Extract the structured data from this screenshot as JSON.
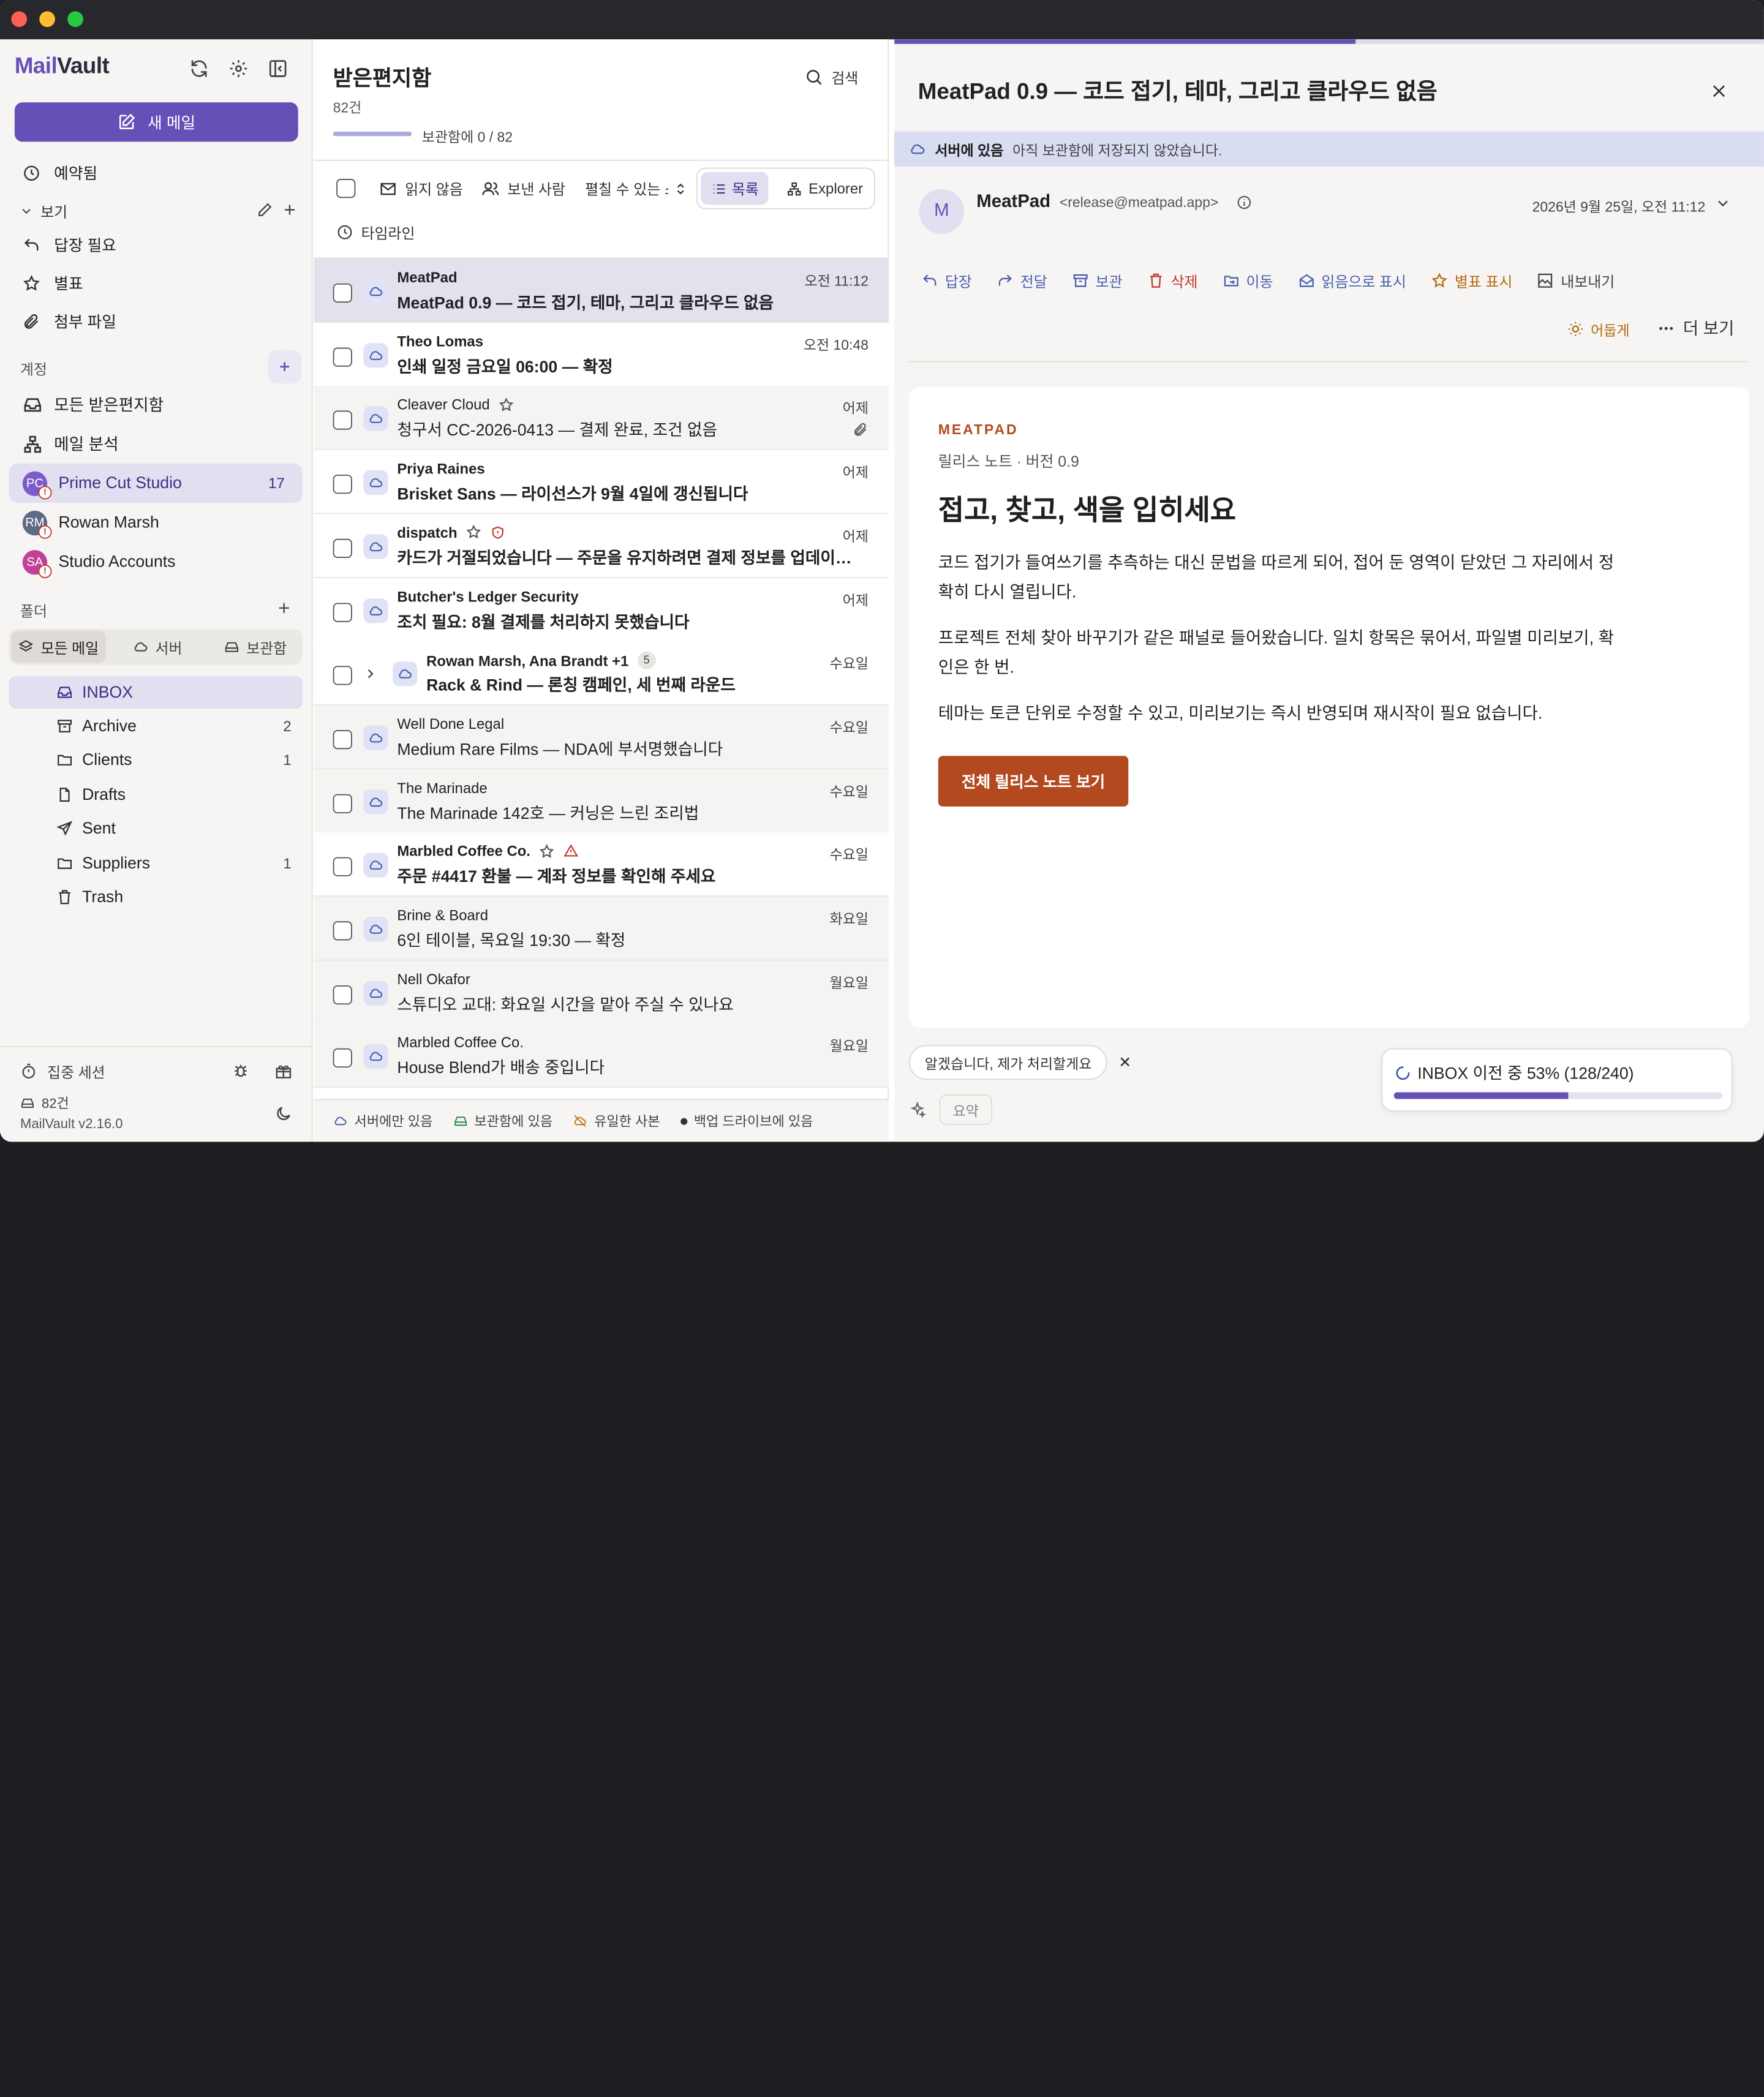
{
  "app": {
    "name_part1": "Mail",
    "name_part2": "Vault"
  },
  "colors": {
    "accent": "#6650b8",
    "danger": "#c0392b",
    "orange": "#b34a1f",
    "link": "#4a5fb0"
  },
  "sidebar": {
    "compose_label": "새 메일",
    "scheduled": "예약됨",
    "views_label": "보기",
    "views": [
      "답장 필요",
      "별표",
      "첨부 파일"
    ],
    "accounts_label": "계정",
    "all_inboxes": "모든 받은편지함",
    "mail_analysis": "메일 분석",
    "accounts": [
      {
        "name": "Prime Cut Studio",
        "initials": "PC",
        "count": "17",
        "color": "#7b5cc9"
      },
      {
        "name": "Rowan Marsh",
        "initials": "RM",
        "count": "",
        "color": "#5d6b87"
      },
      {
        "name": "Studio Accounts",
        "initials": "SA",
        "count": "",
        "color": "#c2409a"
      }
    ],
    "folders_label": "폴더",
    "folder_tabs": [
      "모든 메일",
      "서버",
      "보관함"
    ],
    "folders": [
      {
        "name": "INBOX",
        "count": ""
      },
      {
        "name": "Archive",
        "count": "2"
      },
      {
        "name": "Clients",
        "count": "1"
      },
      {
        "name": "Drafts",
        "count": ""
      },
      {
        "name": "Sent",
        "count": ""
      },
      {
        "name": "Suppliers",
        "count": "1"
      },
      {
        "name": "Trash",
        "count": ""
      }
    ],
    "focus_session": "집중 세션",
    "storage_count": "82건",
    "version": "MailVault v2.16.0"
  },
  "list": {
    "title": "받은편지함",
    "count": "82건",
    "search_label": "검색",
    "vault_progress": "보관함에 0 / 82",
    "filter_unread": "읽지 않음",
    "filter_sender": "보낸 사람",
    "filter_expandable": "펼칠 수 있는 스",
    "view_list": "목록",
    "view_explorer": "Explorer",
    "timeline": "타임라인",
    "messages": [
      {
        "from": "MeatPad",
        "subject": "MeatPad 0.9 — 코드 접기, 테마, 그리고 클라우드 없음",
        "time": "오전 11:12",
        "bold": true,
        "flags": []
      },
      {
        "from": "Theo Lomas",
        "subject": "인쇄 일정 금요일 06:00 — 확정",
        "time": "오전 10:48",
        "bold": true,
        "flags": []
      },
      {
        "from": "Cleaver Cloud",
        "subject": "청구서 CC-2026-0413 — 결제 완료, 조건 없음",
        "time": "어제",
        "bold": false,
        "flags": [
          "star",
          "attach"
        ]
      },
      {
        "from": "Priya Raines",
        "subject": "Brisket Sans — 라이선스가 9월 4일에 갱신됩니다",
        "time": "어제",
        "bold": true,
        "flags": []
      },
      {
        "from": "dispatch",
        "subject": "카드가 거절되었습니다 — 주문을 유지하려면 결제 정보를 업데이트하세요",
        "time": "어제",
        "bold": true,
        "flags": [
          "star",
          "shield"
        ]
      },
      {
        "from": "Butcher's Ledger Security",
        "subject": "조치 필요: 8월 결제를 처리하지 못했습니다",
        "time": "어제",
        "bold": true,
        "flags": []
      },
      {
        "from": "Rowan Marsh, Ana Brandt +1",
        "thread_count": "5",
        "subject": "Rack & Rind — 론칭 캠페인, 세 번째 라운드",
        "time": "수요일",
        "bold": true,
        "flags": [
          "thread"
        ]
      },
      {
        "from": "Well Done Legal",
        "subject": "Medium Rare Films — NDA에 부서명했습니다",
        "time": "수요일",
        "bold": false,
        "flags": []
      },
      {
        "from": "The Marinade",
        "subject": "The Marinade 142호 — 커닝은 느린 조리법",
        "time": "수요일",
        "bold": false,
        "flags": []
      },
      {
        "from": "Marbled Coffee Co.",
        "subject": "주문 #4417 환불 — 계좌 정보를 확인해 주세요",
        "time": "수요일",
        "bold": true,
        "flags": [
          "star",
          "warn"
        ]
      },
      {
        "from": "Brine & Board",
        "subject": "6인 테이블, 목요일 19:30 — 확정",
        "time": "화요일",
        "bold": false,
        "flags": []
      },
      {
        "from": "Nell Okafor",
        "subject": "스튜디오 교대: 화요일 시간을 맡아 주실 수 있나요",
        "time": "월요일",
        "bold": false,
        "flags": []
      },
      {
        "from": "Marbled Coffee Co.",
        "subject": "House Blend가 배송 중입니다",
        "time": "월요일",
        "bold": false,
        "flags": []
      }
    ],
    "legend": [
      "서버에만 있음",
      "보관함에 있음",
      "유일한 사본",
      "백업 드라이브에 있음"
    ]
  },
  "reader": {
    "subject": "MeatPad 0.9 — 코드 접기, 테마, 그리고 클라우드 없음",
    "banner_strong": "서버에 있음",
    "banner_text": "아직 보관함에 저장되지 않았습니다.",
    "sender_initial": "M",
    "sender_name": "MeatPad",
    "sender_email": "<release@meatpad.app>",
    "date": "2026년 9월 25일, 오전 11:12",
    "actions": [
      "답장",
      "전달",
      "보관",
      "삭제",
      "이동",
      "읽음으로 표시",
      "별표 표시",
      "내보내기"
    ],
    "dark_label": "어둡게",
    "more_label": "더 보기",
    "body": {
      "brand": "MEATPAD",
      "kicker": "릴리스 노트 · 버전 0.9",
      "headline": "접고, 찾고, 색을 입히세요",
      "p1": "코드 접기가 들여쓰기를 추측하는 대신 문법을 따르게 되어, 접어 둔 영역이 닫았던 그 자리에서 정확히 다시 열립니다.",
      "p2": "프로젝트 전체 찾아 바꾸기가 같은 패널로 들어왔습니다. 일치 항목은 묶어서, 파일별 미리보기, 확인은 한 번.",
      "p3": "테마는 토큰 단위로 수정할 수 있고, 미리보기는 즉시 반영되며 재시작이 필요 없습니다.",
      "cta": "전체 릴리스 노트 보기"
    },
    "quick_reply": "알겠습니다, 제가 처리할게요",
    "summary_label": "요약",
    "migration": {
      "text": "INBOX 이전 중 53% (128/240)",
      "progress": 0.53
    }
  }
}
